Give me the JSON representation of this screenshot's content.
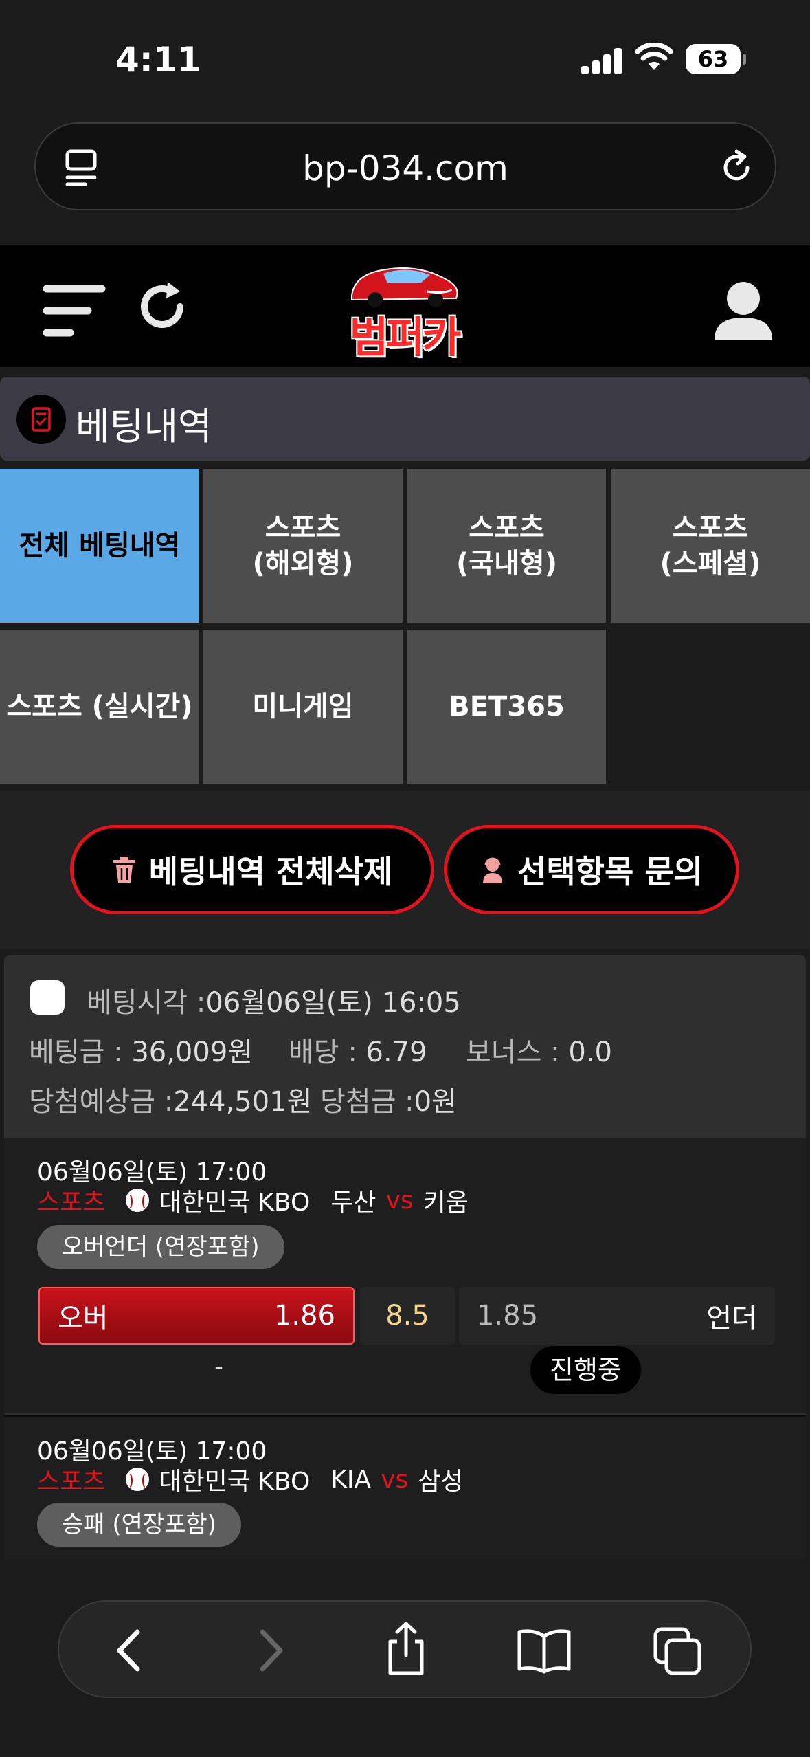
{
  "status_bar": {
    "time": "4:11",
    "battery": "63"
  },
  "browser": {
    "url": "bp-034.com"
  },
  "header": {
    "logo_text": "범퍼카"
  },
  "section": {
    "title": "베팅내역"
  },
  "tabs": [
    {
      "label": "전체 베팅내역",
      "active": true
    },
    {
      "label": "스포츠\n(해외형)",
      "active": false
    },
    {
      "label": "스포츠\n(국내형)",
      "active": false
    },
    {
      "label": "스포츠\n(스페셜)",
      "active": false
    },
    {
      "label": "스포츠 (실시간)",
      "active": false
    },
    {
      "label": "미니게임",
      "active": false
    },
    {
      "label": "BET365",
      "active": false
    }
  ],
  "actions": {
    "delete_all": "베팅내역 전체삭제",
    "inquiry": "선택항목 문의"
  },
  "bet": {
    "time_label": "베팅시각 :",
    "time_value": "06월06일(토) 16:05",
    "amount_label": "베팅금 :",
    "amount_value": "36,009원",
    "odds_label": "배당 :",
    "odds_value": "6.79",
    "bonus_label": "보너스 :",
    "bonus_value": "0.0",
    "expected_label": "당첨예상금 :",
    "expected_value": "244,501원",
    "win_label": "당첨금 :",
    "win_value": "0원",
    "games": [
      {
        "datetime": "06월06일(토) 17:00",
        "sport": "스포츠",
        "league": "대한민국 KBO",
        "home": "두산",
        "vs": "vs",
        "away": "키움",
        "market": "오버언더 (연장포함)",
        "over_label": "오버",
        "over_odds": "1.86",
        "line": "8.5",
        "under_odds": "1.85",
        "under_label": "언더",
        "score": "-",
        "status": "진행중"
      },
      {
        "datetime": "06월06일(토) 17:00",
        "sport": "스포츠",
        "league": "대한민국 KBO",
        "home": "KIA",
        "vs": "vs",
        "away": "삼성",
        "market": "승패 (연장포함)"
      }
    ]
  }
}
